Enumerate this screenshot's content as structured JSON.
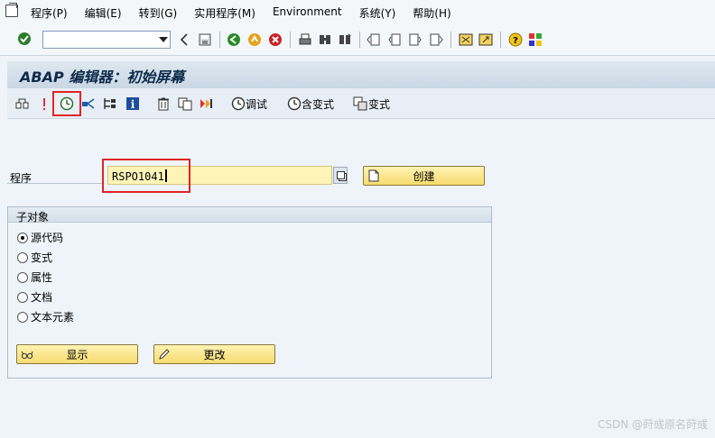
{
  "menubar": {
    "items": [
      "程序(P)",
      "编辑(E)",
      "转到(G)",
      "实用程序(M)",
      "Environment",
      "系统(Y)",
      "帮助(H)"
    ]
  },
  "std_toolbar": {
    "command_field_value": ""
  },
  "title": "ABAP 编辑器：初始屏幕",
  "app_toolbar": {
    "debug_label": "调试",
    "with_variant_label": "含变式",
    "variant_label": "变式"
  },
  "program_field": {
    "label": "程序",
    "value": "RSPO1041"
  },
  "create_button_label": "创建",
  "subobjects": {
    "title": "子对象",
    "options": [
      {
        "label": "源代码",
        "selected": true
      },
      {
        "label": "变式",
        "selected": false
      },
      {
        "label": "属性",
        "selected": false
      },
      {
        "label": "文档",
        "selected": false
      },
      {
        "label": "文本元素",
        "selected": false
      }
    ]
  },
  "display_button_label": "显示",
  "change_button_label": "更改",
  "watermark": "CSDN @莳彧原名莳彧",
  "colors": {
    "highlight_red": "#e32323",
    "input_yellow": "#fff4b8",
    "button_yellow": "#f7dc6f"
  }
}
